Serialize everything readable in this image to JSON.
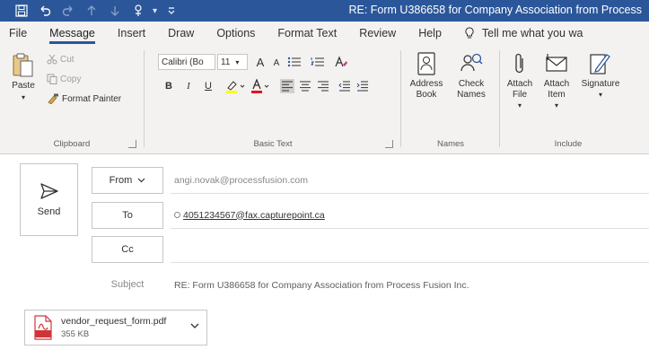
{
  "window": {
    "title": "RE: Form U386658 for Company Association from Process"
  },
  "quick_access": {
    "icons": [
      "save-icon",
      "undo-icon",
      "redo-icon",
      "up-arrow-icon",
      "down-arrow-icon",
      "touch-mode-icon",
      "customize-icon"
    ],
    "separator": "▾"
  },
  "tabs": [
    {
      "label": "File",
      "active": false
    },
    {
      "label": "Message",
      "active": true
    },
    {
      "label": "Insert",
      "active": false
    },
    {
      "label": "Draw",
      "active": false
    },
    {
      "label": "Options",
      "active": false
    },
    {
      "label": "Format Text",
      "active": false
    },
    {
      "label": "Review",
      "active": false
    },
    {
      "label": "Help",
      "active": false
    }
  ],
  "tell_me": "Tell me what you wa",
  "ribbon": {
    "clipboard": {
      "label": "Clipboard",
      "paste": "Paste",
      "cut": "Cut",
      "copy": "Copy",
      "format_painter": "Format Painter"
    },
    "basic_text": {
      "label": "Basic Text",
      "font_name": "Calibri (Bo",
      "font_size": "11",
      "grow": "A",
      "shrink": "A",
      "bold": "B",
      "italic": "I",
      "underline": "U"
    },
    "names": {
      "label": "Names",
      "address_book": "Address Book",
      "check_names": "Check Names"
    },
    "include": {
      "label": "Include",
      "attach_file": "Attach File",
      "attach_item": "Attach Item",
      "signature": "Signature"
    }
  },
  "compose": {
    "send_label": "Send",
    "from_label": "From",
    "from_value": "angi.novak@processfusion.com",
    "to_label": "To",
    "to_value": "4051234567@fax.capturepoint.ca",
    "cc_label": "Cc",
    "cc_value": "",
    "subject_label": "Subject",
    "subject_value": "RE: Form U386658 for Company Association from Process Fusion Inc."
  },
  "attachment": {
    "file_name": "vendor_request_form.pdf",
    "file_size": "355 KB"
  },
  "colors": {
    "title_bar": "#2b579a",
    "ribbon_bg": "#f3f2f1",
    "pdf_red": "#d13438"
  }
}
